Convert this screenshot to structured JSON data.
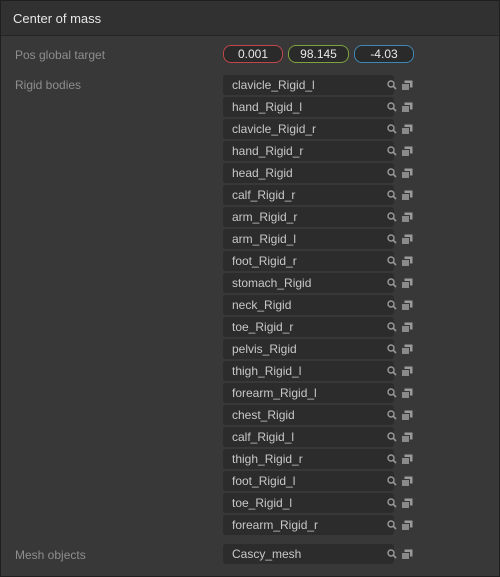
{
  "panel": {
    "title": "Center of mass"
  },
  "pos_global_target": {
    "label": "Pos global target",
    "x": "0.001",
    "y": "98.145",
    "z": "-4.03"
  },
  "rigid_bodies": {
    "label": "Rigid bodies",
    "items": [
      "clavicle_Rigid_l",
      "hand_Rigid_l",
      "clavicle_Rigid_r",
      "hand_Rigid_r",
      "head_Rigid",
      "calf_Rigid_r",
      "arm_Rigid_r",
      "arm_Rigid_l",
      "foot_Rigid_r",
      "stomach_Rigid",
      "neck_Rigid",
      "toe_Rigid_r",
      "pelvis_Rigid",
      "thigh_Rigid_l",
      "forearm_Rigid_l",
      "chest_Rigid",
      "calf_Rigid_l",
      "thigh_Rigid_r",
      "foot_Rigid_l",
      "toe_Rigid_l",
      "forearm_Rigid_r"
    ]
  },
  "mesh_objects": {
    "label": "Mesh objects",
    "value": "Cascy_mesh"
  },
  "colors": {
    "x_axis": "#c0464a",
    "y_axis": "#7ea23e",
    "z_axis": "#3f86b5"
  },
  "icons": {
    "search": "search-icon",
    "copy": "copy-icon"
  }
}
